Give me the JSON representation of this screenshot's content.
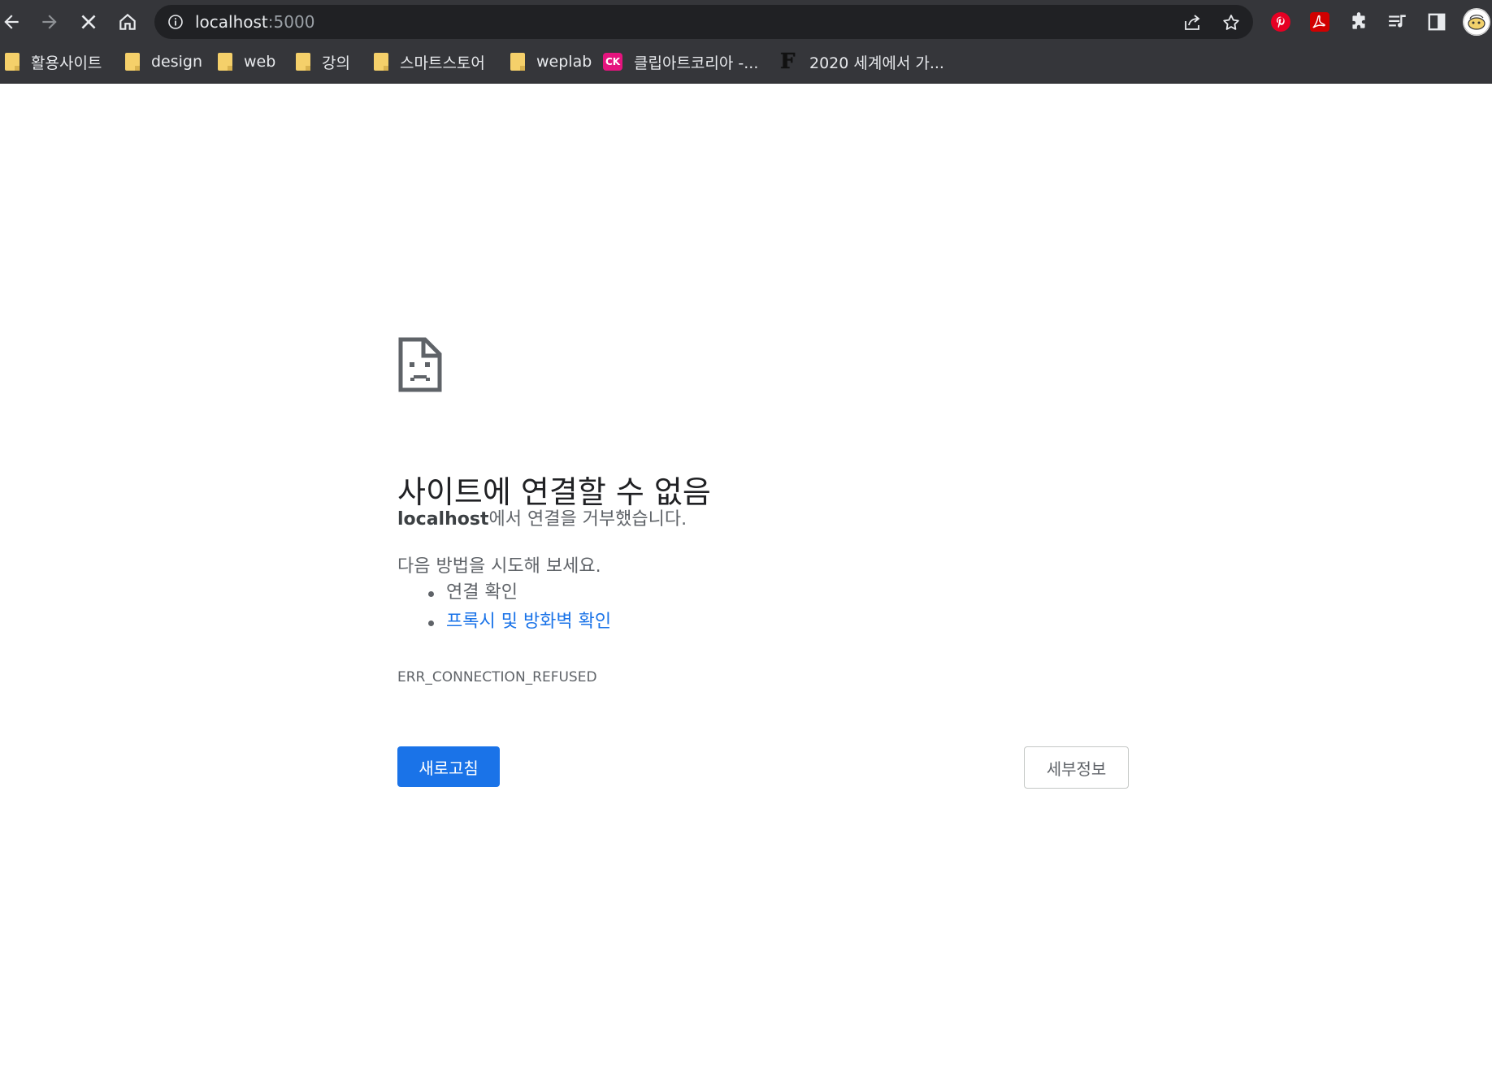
{
  "browser": {
    "url_host": "localhost",
    "url_port": ":5000",
    "colors": {
      "toolbar": "#35363a",
      "omnibox": "#202124",
      "text": "#e8eaed"
    }
  },
  "bookmarks": [
    {
      "label": "활용사이트",
      "icon": "folder-icon"
    },
    {
      "label": "design",
      "icon": "folder-icon"
    },
    {
      "label": "web",
      "icon": "folder-icon"
    },
    {
      "label": "강의",
      "icon": "folder-icon"
    },
    {
      "label": "스마트스토어",
      "icon": "folder-icon"
    },
    {
      "label": "weplab",
      "icon": "folder-icon"
    },
    {
      "label": "클립아트코리아 -...",
      "icon": "clipartkorea-logo-icon",
      "logo_text": "CK"
    },
    {
      "label": "2020 세계에서 가...",
      "icon": "f-logo-icon",
      "logo_text": "F"
    }
  ],
  "error": {
    "title": "사이트에 연결할 수 없음",
    "host": "localhost",
    "desc_suffix": "에서 연결을 거부했습니다.",
    "try_text": "다음 방법을 시도해 보세요.",
    "suggestions": [
      {
        "text": "연결 확인",
        "is_link": false
      },
      {
        "text": "프록시 및 방화벽 확인",
        "is_link": true
      }
    ],
    "code": "ERR_CONNECTION_REFUSED",
    "reload_label": "새로고침",
    "details_label": "세부정보",
    "colors": {
      "primary": "#1a73e8",
      "text": "#5f6368",
      "title": "#202124"
    }
  }
}
